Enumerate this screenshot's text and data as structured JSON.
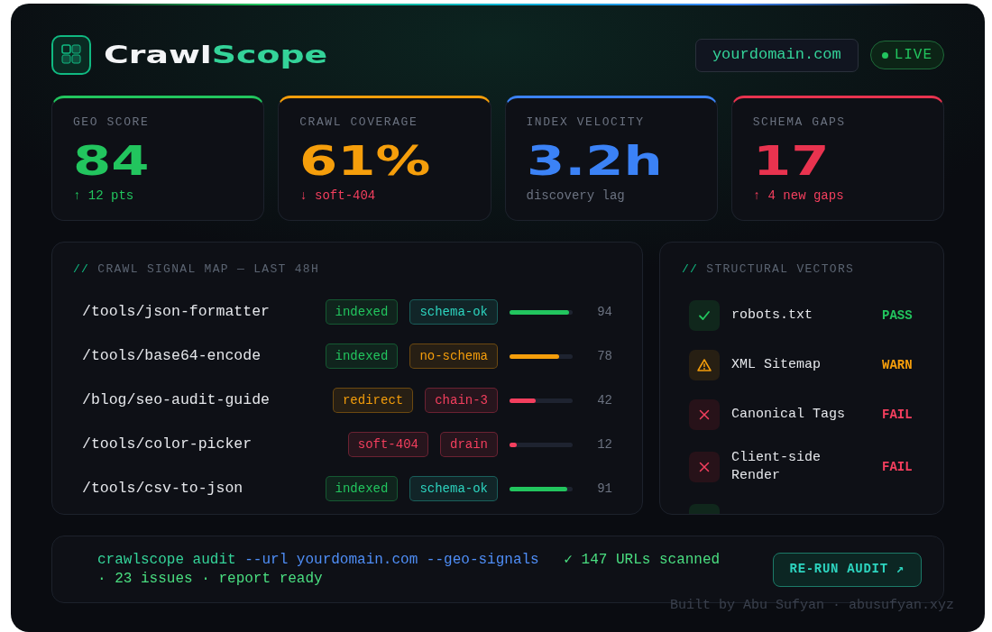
{
  "header": {
    "logo": {
      "text_primary": "Crawl",
      "text_accent": "Scope"
    },
    "domain": "yourdomain.com",
    "live_badge": "LIVE"
  },
  "metrics": [
    {
      "label": "GEO SCORE",
      "value": "84",
      "note": {
        "text": "↑ 12 pts",
        "kind": "good"
      },
      "color": "#22c55e"
    },
    {
      "label": "CRAWL COVERAGE",
      "value": "61%",
      "note": {
        "text": "↓ soft-404",
        "kind": "bad"
      },
      "color": "#f59e0b"
    },
    {
      "label": "INDEX VELOCITY",
      "value": "3.2h",
      "note": {
        "text": "discovery lag",
        "kind": "muted"
      },
      "color": "#3b82f6"
    },
    {
      "label": "SCHEMA GAPS",
      "value": "17",
      "note": {
        "text": "↑ 4 new gaps",
        "kind": "bad"
      },
      "color": "#e8334f"
    }
  ],
  "signal_map": {
    "title_prefix": "//",
    "title": "CRAWL SIGNAL MAP — LAST 48H",
    "rows": [
      {
        "path": "/tools/json-formatter",
        "tags": [
          {
            "label": "indexed",
            "color": "#22c55e"
          },
          {
            "label": "schema-ok",
            "color": "#2dd4bf"
          }
        ],
        "level": 0.94,
        "color": "#22c55e",
        "score": "94"
      },
      {
        "path": "/tools/base64-encode",
        "tags": [
          {
            "label": "indexed",
            "color": "#22c55e"
          },
          {
            "label": "no-schema",
            "color": "#f59e0b"
          }
        ],
        "level": 0.78,
        "color": "#f59e0b",
        "score": "78"
      },
      {
        "path": "/blog/seo-audit-guide",
        "tags": [
          {
            "label": "redirect",
            "color": "#f59e0b"
          },
          {
            "label": "chain-3",
            "color": "#f43f5e"
          }
        ],
        "level": 0.42,
        "color": "#f43f5e",
        "score": "42"
      },
      {
        "path": "/tools/color-picker",
        "tags": [
          {
            "label": "soft-404",
            "color": "#f43f5e"
          },
          {
            "label": "drain",
            "color": "#f43f5e"
          }
        ],
        "level": 0.12,
        "color": "#f43f5e",
        "score": "12"
      },
      {
        "path": "/tools/csv-to-json",
        "tags": [
          {
            "label": "indexed",
            "color": "#22c55e"
          },
          {
            "label": "schema-ok",
            "color": "#2dd4bf"
          }
        ],
        "level": 0.91,
        "color": "#22c55e",
        "score": "91"
      }
    ]
  },
  "structural_vectors": {
    "title_prefix": "//",
    "title": "STRUCTURAL VECTORS",
    "items": [
      {
        "kind": "pass",
        "label": "robots.txt",
        "status": "PASS"
      },
      {
        "kind": "warn",
        "label": "XML Sitemap",
        "status": "WARN"
      },
      {
        "kind": "fail",
        "label": "Canonical Tags",
        "status": "FAIL"
      },
      {
        "kind": "fail",
        "label": "Client-side Render",
        "status": "FAIL"
      },
      {
        "kind": "pass"
      }
    ]
  },
  "footer": {
    "command": [
      {
        "kind": "command",
        "text": "crawlscope audit"
      },
      {
        "kind": "flag",
        "text": "--url yourdomain.com --geo-signals"
      },
      {
        "kind": "result",
        "text": "✓ 147 URLs scanned · 23 issues · report ready"
      }
    ],
    "button": "RE-RUN AUDIT ↗",
    "credit": "Built by Abu Sufyan · abusufyan.xyz"
  }
}
